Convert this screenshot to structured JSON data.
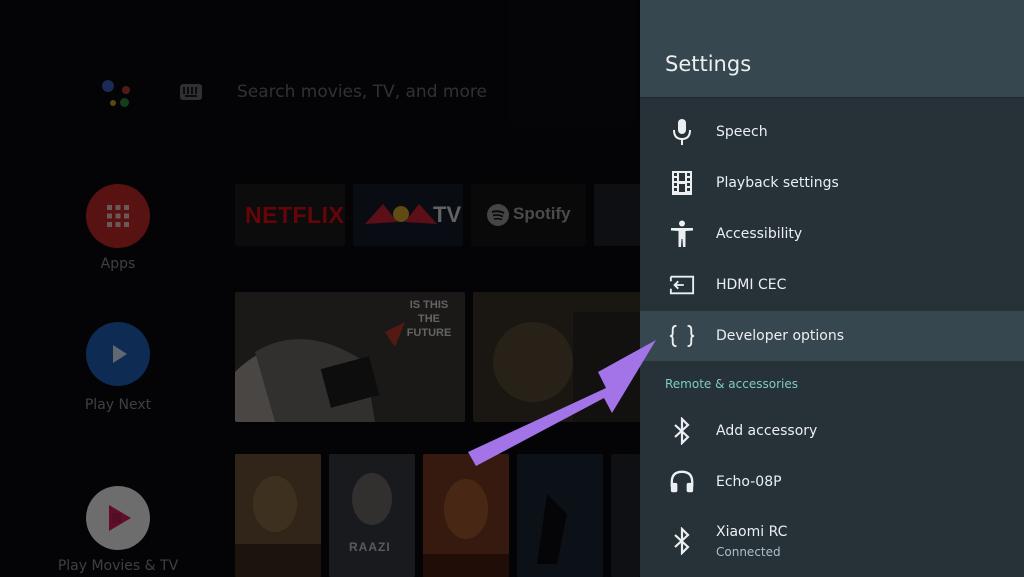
{
  "launcher": {
    "search_placeholder": "Search movies, TV, and more",
    "nav": {
      "apps": "Apps",
      "play_next": "Play Next",
      "play_movies": "Play Movies & TV"
    },
    "apps_row": {
      "netflix": "NETFLIX",
      "redbull": "TV",
      "spotify": "Spotify"
    },
    "play_next_tiles": {
      "banner": "IS THIS THE FUTURE"
    },
    "movie_tiles": {
      "raazi": "RAAZI"
    }
  },
  "settings": {
    "title": "Settings",
    "items": [
      {
        "label": "Speech",
        "icon": "microphone-icon"
      },
      {
        "label": "Playback settings",
        "icon": "film-icon"
      },
      {
        "label": "Accessibility",
        "icon": "accessibility-icon"
      },
      {
        "label": "HDMI CEC",
        "icon": "input-icon"
      },
      {
        "label": "Developer options",
        "icon": "braces-icon",
        "focused": true
      }
    ],
    "section_remote": "Remote & accessories",
    "remote_items": [
      {
        "label": "Add accessory",
        "icon": "bluetooth-icon"
      },
      {
        "label": "Echo-08P",
        "icon": "headphones-icon"
      },
      {
        "label": "Xiaomi RC",
        "sublabel": "Connected",
        "icon": "bluetooth-icon"
      }
    ]
  },
  "colors": {
    "panel": "#263238",
    "header": "#37474f",
    "focus": "#37474f",
    "accent": "#80cbc4",
    "arrow": "#a373e8",
    "netflix_red": "#b1060f"
  }
}
